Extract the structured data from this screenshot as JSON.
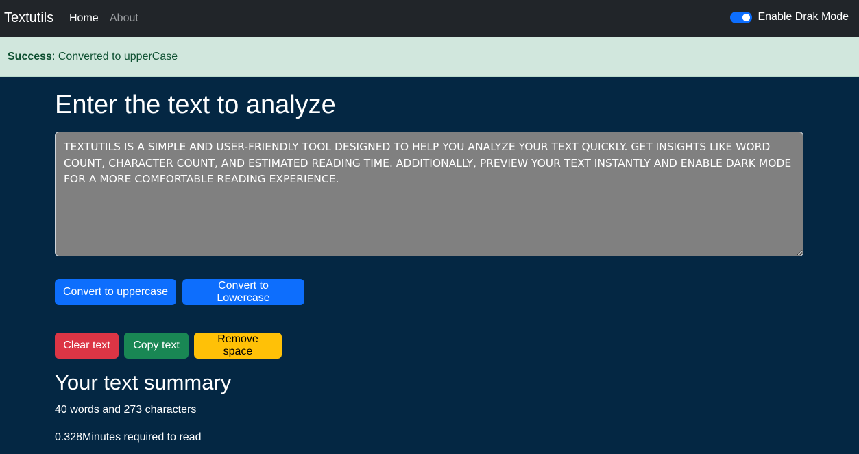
{
  "navbar": {
    "brand": "Textutils",
    "links": [
      {
        "label": "Home"
      },
      {
        "label": "About"
      }
    ],
    "toggle_label": "Enable Drak Mode"
  },
  "alert": {
    "type": "Success",
    "message": ": Converted to upperCase"
  },
  "main": {
    "heading": "Enter the text to analyze",
    "textarea_value": "TEXTUTILS IS A SIMPLE AND USER-FRIENDLY TOOL DESIGNED TO HELP YOU ANALYZE YOUR TEXT QUICKLY. GET INSIGHTS LIKE WORD COUNT, CHARACTER COUNT, AND ESTIMATED READING TIME. ADDITIONALLY, PREVIEW YOUR TEXT INSTANTLY AND ENABLE DARK MODE FOR A MORE COMFORTABLE READING EXPERIENCE.",
    "buttons": {
      "uppercase": "Convert to uppercase",
      "lowercase": "Convert to Lowercase",
      "clear": "Clear text",
      "copy": "Copy text",
      "remove_space": "Remove space"
    }
  },
  "summary": {
    "title": "Your text summary",
    "counts": "40 words and 273 characters",
    "read_time": "0.328Minutes required to read"
  },
  "colors": {
    "background": "#042743",
    "navbar": "#212529",
    "alert_bg": "#d1e7dd",
    "primary": "#0d6efd",
    "danger": "#dc3545",
    "success": "#198754",
    "warning": "#ffc107"
  }
}
